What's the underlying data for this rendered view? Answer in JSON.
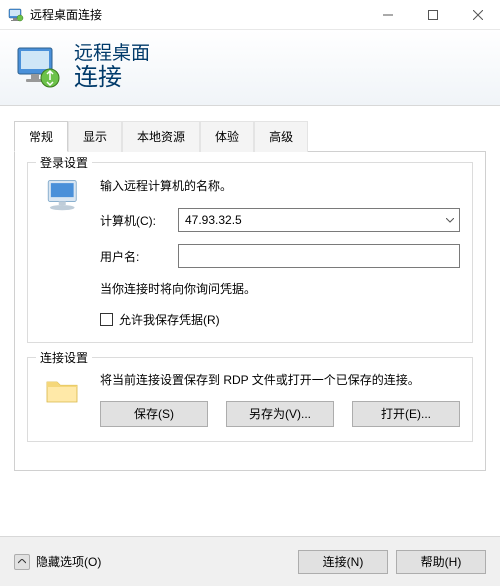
{
  "titlebar": {
    "title": "远程桌面连接"
  },
  "header": {
    "line1": "远程桌面",
    "line2": "连接"
  },
  "tabs": [
    {
      "label": "常规",
      "active": true
    },
    {
      "label": "显示",
      "active": false
    },
    {
      "label": "本地资源",
      "active": false
    },
    {
      "label": "体验",
      "active": false
    },
    {
      "label": "高级",
      "active": false
    }
  ],
  "login": {
    "legend": "登录设置",
    "prompt": "输入远程计算机的名称。",
    "computer_label": "计算机(C):",
    "computer_value": "47.93.32.5",
    "username_label": "用户名:",
    "username_value": "",
    "note": "当你连接时将向你询问凭据。",
    "save_creds_label": "允许我保存凭据(R)"
  },
  "conn": {
    "legend": "连接设置",
    "text": "将当前连接设置保存到 RDP 文件或打开一个已保存的连接。",
    "save": "保存(S)",
    "save_as": "另存为(V)...",
    "open": "打开(E)..."
  },
  "footer": {
    "hide_options": "隐藏选项(O)",
    "connect": "连接(N)",
    "help": "帮助(H)"
  }
}
